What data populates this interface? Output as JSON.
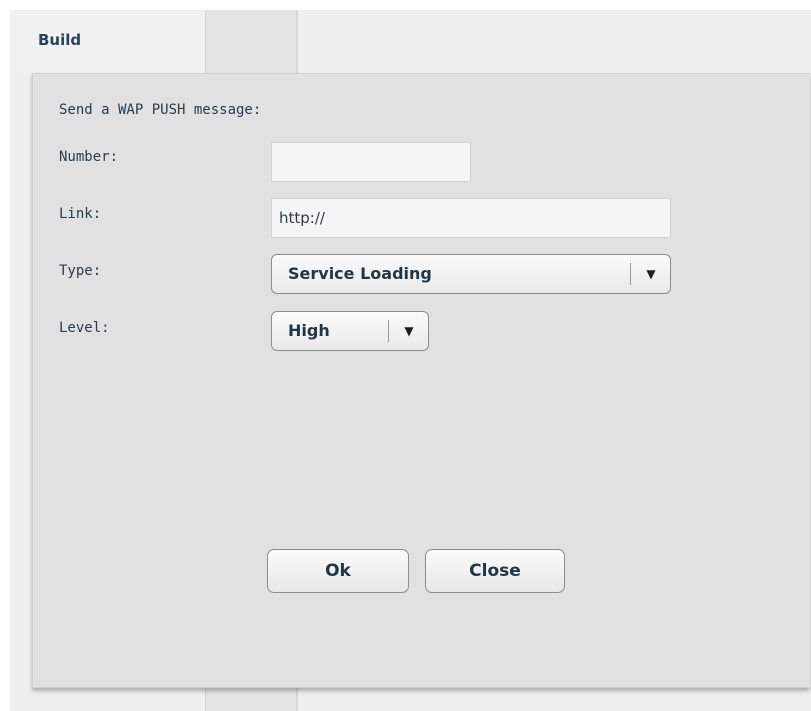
{
  "tabs": {
    "build_label": "Build"
  },
  "dialog": {
    "title": "Send a WAP PUSH message:",
    "number_label": "Number:",
    "number_value": "",
    "link_label": "Link:",
    "link_value": "http://",
    "type_label": "Type:",
    "type_value": "Service Loading",
    "level_label": "Level:",
    "level_value": "High",
    "dropdown_arrow": "▼",
    "ok_label": "Ok",
    "close_label": "Close"
  },
  "colors": {
    "text": "#1f3647",
    "panel": "#e1e1e1",
    "background": "#efefef"
  },
  "icons": {
    "dropdown": "chevron-down-icon"
  }
}
